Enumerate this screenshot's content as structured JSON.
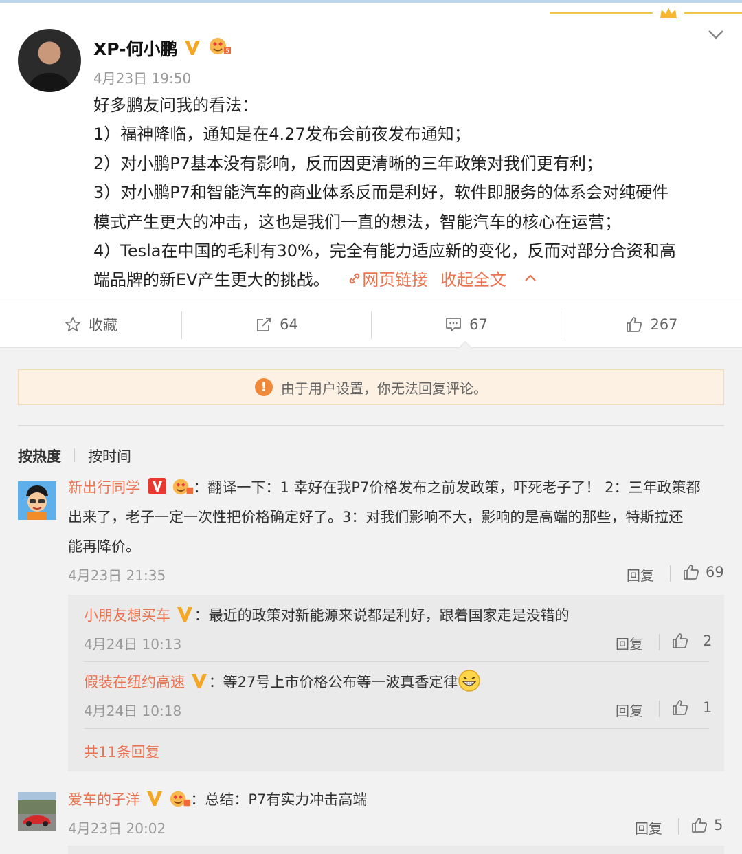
{
  "post": {
    "author": "XP-何小鹏",
    "time": "4月23日 19:50",
    "lines": [
      "好多鹏友问我的看法：",
      "1）福神降临，通知是在4.27发布会前夜发布通知；",
      "2）对小鹏P7基本没有影响，反而因更清晰的三年政策对我们更有利；",
      "3）对小鹏P7和智能汽车的商业体系反而是利好，软件即服务的体系会对纯硬件",
      "模式产生更大的冲击，这也是我们一直的想法，智能汽车的核心在运营；",
      "4）Tesla在中国的毛利有30%，完全有能力适应新的变化，反而对部分合资和高",
      "端品牌的新EV产生更大的挑战。"
    ],
    "link_label": "网页链接",
    "collapse_label": "收起全文"
  },
  "actions": {
    "favorite": "收藏",
    "repost_count": "64",
    "comment_count": "67",
    "like_count": "267"
  },
  "notice": "由于用户设置，你无法回复评论。",
  "sort": {
    "hot": "按热度",
    "time": "按时间"
  },
  "comments": [
    {
      "user": "新出行同学",
      "lines": [
        "：翻译一下：1 幸好在我P7价格发布之前发政策，吓死老子了！ 2：三年政策都",
        "出来了，老子一定一次性把价格确定好了。3：对我们影响不大，影响的是高端的那些，特斯拉还",
        "能再降价。"
      ],
      "time": "4月23日 21:35",
      "reply": "回复",
      "likes": "69",
      "replies": [
        {
          "user": "小朋友想买车",
          "text": "：最近的政策对新能源来说都是利好，跟着国家走是没错的",
          "time": "4月24日 10:13",
          "reply": "回复",
          "likes": "2"
        },
        {
          "user": "假装在纽约高速",
          "text": "：等27号上市价格公布等一波真香定律",
          "time": "4月24日 10:18",
          "reply": "回复",
          "likes": "1"
        }
      ],
      "total_replies": "共11条回复"
    },
    {
      "user": "爱车的子洋",
      "text": "：总结：P7有实力冲击高端",
      "time": "4月23日 20:02",
      "reply": "回复",
      "likes": "5"
    }
  ],
  "colors": {
    "accent": "#eb7350",
    "verified": "#f5a623",
    "notice_bg": "#fdf1e4"
  }
}
